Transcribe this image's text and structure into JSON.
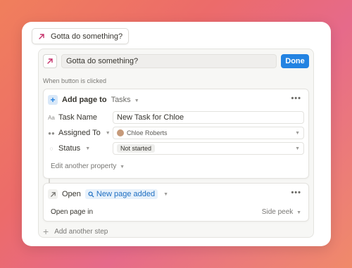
{
  "colors": {
    "accent": "#2383e2",
    "arrow": "#c5326b",
    "new_page_bg": "#e7f1fb"
  },
  "chip": {
    "icon": "arrow-up-right-icon",
    "label": "Gotta do something?"
  },
  "editor": {
    "title_value": "Gotta do something?",
    "done_label": "Done",
    "when_label": "When button is clicked",
    "add_page": {
      "action_label": "Add page to",
      "database": "Tasks",
      "more": "•••",
      "properties": [
        {
          "icon": "Aa",
          "name": "Task Name",
          "value": "New Task for Chloe"
        },
        {
          "icon": "people-icon",
          "name": "Assigned To",
          "value": "Chloe Roberts"
        },
        {
          "icon": "status-icon",
          "name": "Status",
          "value": "Not started"
        }
      ],
      "edit_another": "Edit another property"
    },
    "open_step": {
      "action_label": "Open",
      "target": "New page added",
      "more": "•••",
      "open_in_label": "Open page in",
      "open_in_value": "Side peek"
    },
    "add_step_label": "Add another step"
  }
}
